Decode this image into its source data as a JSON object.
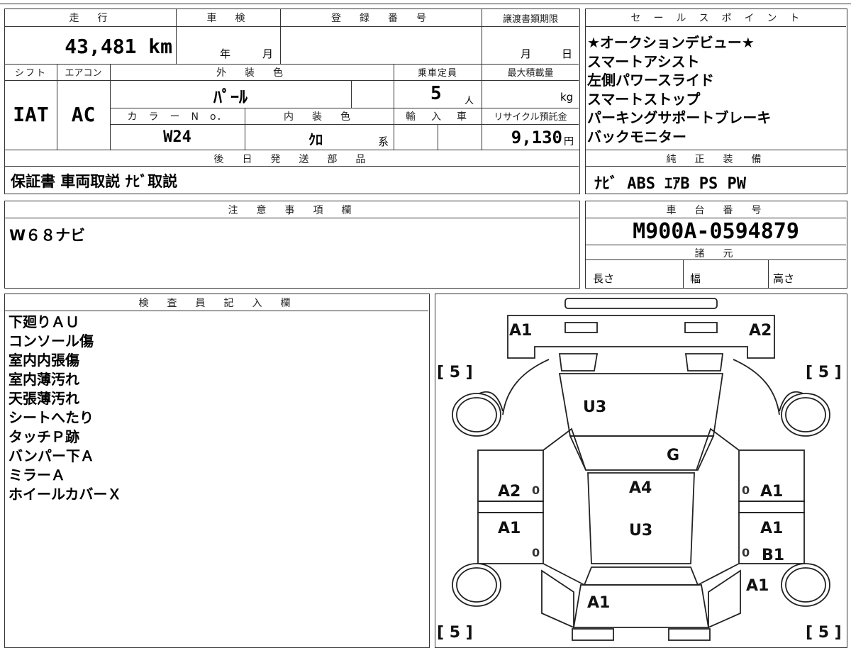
{
  "vehicle": {
    "h_mileage": "走　行",
    "mileage": "43,481 km",
    "h_inspection": "車　検",
    "year": "年",
    "month": "月",
    "h_registration": "登　録　番　号",
    "h_transfer": "譲渡書類期限",
    "transfer_month": "月",
    "transfer_day": "日",
    "h_shift": "シフト",
    "shift": "IAT",
    "h_aircon": "エアコン",
    "aircon": "AC",
    "h_exterior": "外　装　色",
    "exterior": "ﾊﾟｰﾙ",
    "h_capacity": "乗車定員",
    "capacity": "5",
    "capacity_unit": "人",
    "h_max_load": "最大積載量",
    "load_unit": "kg",
    "h_color_no": "カ　ラ　ー　N　o．",
    "color_no": "W24",
    "h_interior": "内　装　色",
    "interior": "ｸﾛ",
    "interior_suffix": "系",
    "h_import": "輸　入　車",
    "h_recycle": "リサイクル預託金",
    "recycle": "9,130",
    "recycle_unit": "円"
  },
  "delivery": {
    "header": "後　日　発　送　部　品",
    "items": "保証書 車両取説 ﾅﾋﾞ取説"
  },
  "sales": {
    "header": "セ　ー　ル　ス　ポ　イ　ン　ト",
    "points": [
      "★オークションデビュー★",
      "スマートアシスト",
      "左側パワースライド",
      "スマートストップ",
      "パーキングサポートブレーキ",
      "バックモニター"
    ]
  },
  "equipment": {
    "header": "純　正　装　備",
    "items": "ﾅﾋﾞ ABS ｴｱB PS PW"
  },
  "notes": {
    "header": "注　意　事　項　欄",
    "text": "W６８ナビ"
  },
  "chassis": {
    "header": "車　台　番　号",
    "number": "M900A-0594879"
  },
  "specs": {
    "header": "諸　元",
    "length": "長さ",
    "width": "幅",
    "height": "高さ"
  },
  "inspector": {
    "header": "検　査　員　記　入　欄",
    "lines": [
      "下廻りＡＵ",
      "コンソール傷",
      "室内内張傷",
      "室内薄汚れ",
      "天張薄汚れ",
      "シートへたり",
      "タッチＰ跡",
      "バンパー下Ａ",
      "ミラーＡ",
      "ホイールカバーＸ"
    ]
  },
  "diagram": {
    "tire_fl": "[ 5 ]",
    "tire_fr": "[ 5 ]",
    "tire_rl": "[ 5 ]",
    "tire_rr": "[ 5 ]",
    "front_left": "A1",
    "front_right": "A2",
    "hood": "U3",
    "windshield": "G",
    "roof_a": "A4",
    "roof_u": "U3",
    "left_front_door": "A2",
    "right_front_door": "A1",
    "left_rear_door": "A1",
    "right_rear_door_a": "A1",
    "right_rear_door_b": "B1",
    "right_rear_fender": "A1",
    "rear": "A1",
    "left_front_door_mark": "0",
    "left_rear_door_mark": "0",
    "right_front_door_mark": "0",
    "right_rear_door_mark": "0"
  }
}
